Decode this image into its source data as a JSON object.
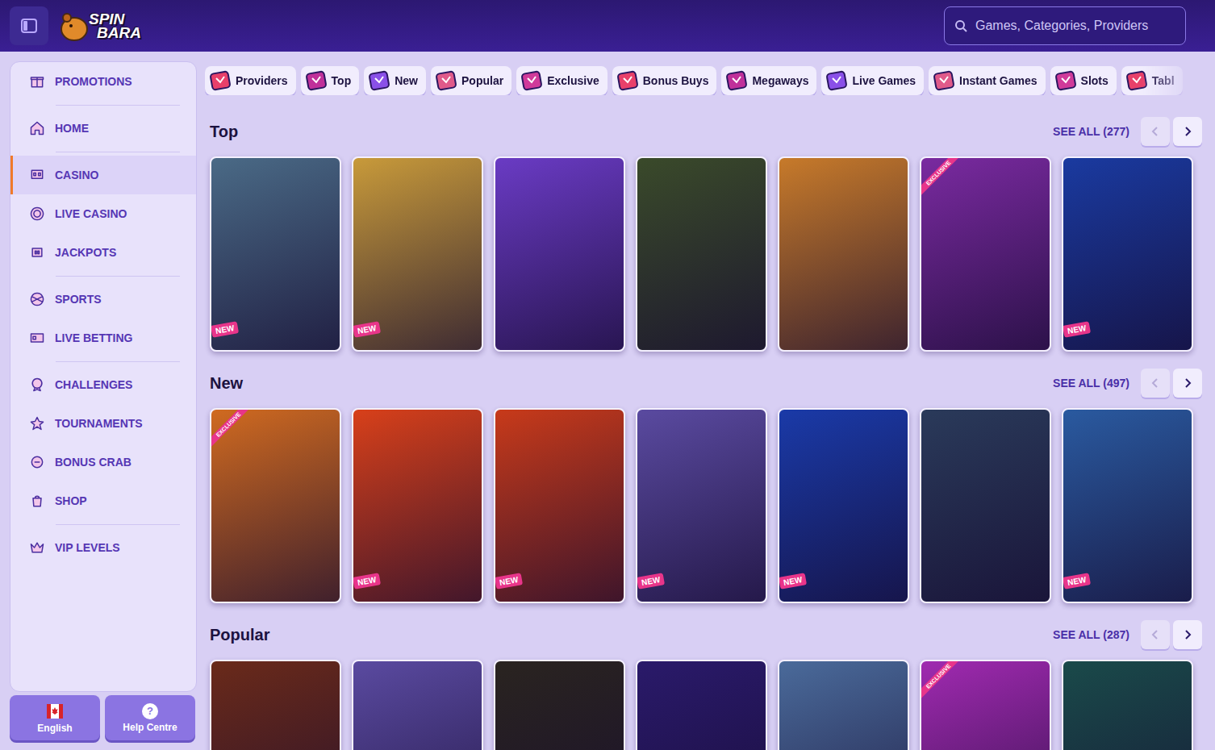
{
  "header": {
    "logo": {
      "line1": "SPIN",
      "line2": "BARA"
    },
    "search": {
      "placeholder": "Games, Categories, Providers"
    }
  },
  "sidebar": {
    "groups": [
      [
        {
          "label": "PROMOTIONS",
          "selected": false
        }
      ],
      [
        {
          "label": "HOME",
          "selected": false
        }
      ],
      [
        {
          "label": "CASINO",
          "selected": true
        },
        {
          "label": "LIVE CASINO",
          "selected": false
        },
        {
          "label": "JACKPOTS",
          "selected": false
        }
      ],
      [
        {
          "label": "SPORTS",
          "selected": false
        },
        {
          "label": "LIVE BETTING",
          "selected": false
        }
      ],
      [
        {
          "label": "CHALLENGES",
          "selected": false
        },
        {
          "label": "TOURNAMENTS",
          "selected": false
        },
        {
          "label": "BONUS CRAB",
          "selected": false
        },
        {
          "label": "SHOP",
          "selected": false
        }
      ],
      [
        {
          "label": "VIP LEVELS",
          "selected": false
        }
      ]
    ],
    "footer": [
      {
        "label": "English",
        "kind": "flag"
      },
      {
        "label": "Help Centre",
        "kind": "help",
        "icon": "?"
      }
    ]
  },
  "categories": [
    {
      "label": "Providers"
    },
    {
      "label": "Top"
    },
    {
      "label": "New"
    },
    {
      "label": "Popular"
    },
    {
      "label": "Exclusive"
    },
    {
      "label": "Bonus Buys"
    },
    {
      "label": "Megaways"
    },
    {
      "label": "Live Games"
    },
    {
      "label": "Instant Games"
    },
    {
      "label": "Slots"
    },
    {
      "label": "Tabl"
    }
  ],
  "sections": [
    {
      "title": "Top",
      "see_all": "SEE ALL (277)",
      "prev_disabled": true,
      "next_disabled": false,
      "tiles": [
        {
          "color": "#4a6a86",
          "badge": "NEW"
        },
        {
          "color": "#c89a3a",
          "badge": "NEW"
        },
        {
          "color": "#6a3bc4",
          "badge": ""
        },
        {
          "color": "#3a4a2a",
          "badge": ""
        },
        {
          "color": "#c77a2a",
          "badge": ""
        },
        {
          "color": "#7a2aa0",
          "badge": "EXCLUSIVE"
        },
        {
          "color": "#1a3aa0",
          "badge": "NEW"
        }
      ]
    },
    {
      "title": "New",
      "see_all": "SEE ALL (497)",
      "prev_disabled": true,
      "next_disabled": false,
      "tiles": [
        {
          "color": "#d06a20",
          "badge": "EXCLUSIVE"
        },
        {
          "color": "#d8401a",
          "badge": "NEW"
        },
        {
          "color": "#c83a1a",
          "badge": "NEW"
        },
        {
          "color": "#5a4aa0",
          "badge": "NEW"
        },
        {
          "color": "#1a3aa8",
          "badge": "NEW"
        },
        {
          "color": "#2a3a5a",
          "badge": ""
        },
        {
          "color": "#2a5aa0",
          "badge": "NEW"
        }
      ]
    },
    {
      "title": "Popular",
      "see_all": "SEE ALL (287)",
      "prev_disabled": true,
      "next_disabled": false,
      "tiles": [
        {
          "color": "#6a2a1a",
          "badge": ""
        },
        {
          "color": "#5a4aa0",
          "badge": ""
        },
        {
          "color": "#2a2420",
          "badge": ""
        },
        {
          "color": "#2a1a6a",
          "badge": ""
        },
        {
          "color": "#4a6a9a",
          "badge": ""
        },
        {
          "color": "#a02ab0",
          "badge": "EXCLUSIVE"
        },
        {
          "color": "#1a4a4a",
          "badge": ""
        }
      ]
    }
  ]
}
